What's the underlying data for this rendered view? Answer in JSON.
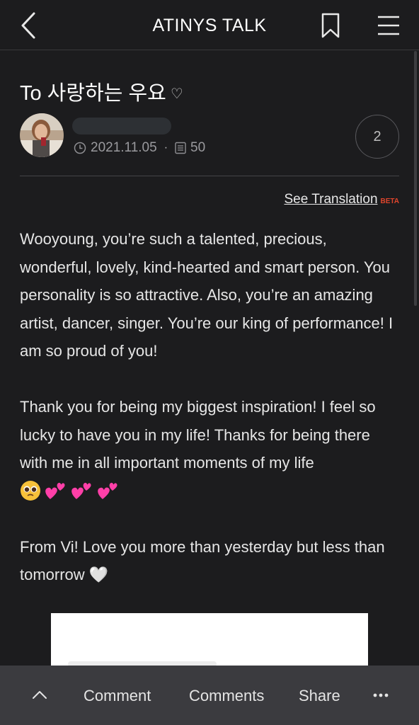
{
  "header": {
    "title": "ATINYS TALK",
    "back_icon": "chevron-left-icon",
    "bookmark_icon": "bookmark-icon",
    "menu_icon": "hamburger-menu-icon"
  },
  "post": {
    "title": "To 사랑하는 우요",
    "title_heart": "♡",
    "date": "2021.11.05",
    "views": "50",
    "comment_count": "2",
    "translate_label": "See Translation",
    "beta_label": "BETA",
    "paragraphs": [
      "Wooyoung, you’re such a talented, precious, wonderful, lovely, kind-hearted and smart person. You personality is so attractive. Also, you’re an amazing artist, dancer, singer. You’re our king of performance! I am so proud of you!",
      "Thank you for being my biggest inspiration! I feel so lucky to have you in my life! Thanks for being there with me in all important moments of my life",
      "From Vi! Love you more than yesterday but less than tomorrow 🤍"
    ],
    "emoji_line": [
      "🥺",
      "💕",
      "💕",
      "💕"
    ]
  },
  "bottom_bar": {
    "comment_label": "Comment",
    "comments_label": "Comments",
    "share_label": "Share"
  },
  "colors": {
    "background": "#1c1c1e",
    "bottom_bar": "#3b3b3f",
    "beta": "#e0452c"
  }
}
